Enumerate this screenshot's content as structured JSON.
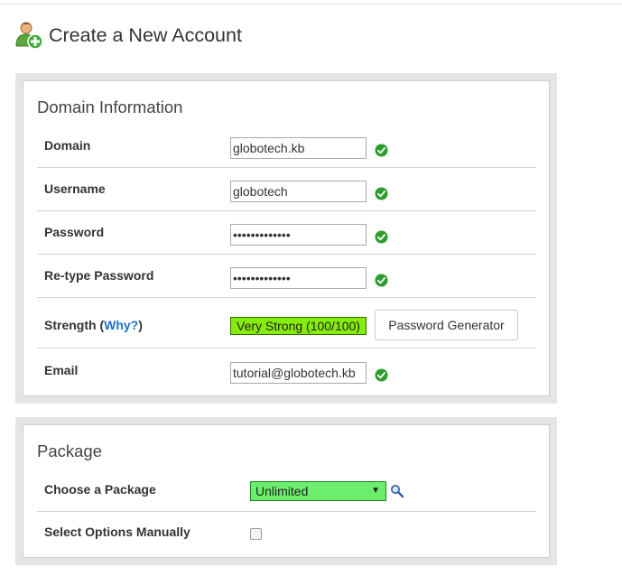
{
  "header": {
    "title": "Create a New Account",
    "icon": "user-add-icon"
  },
  "domain_section": {
    "title": "Domain Information",
    "fields": {
      "domain": {
        "label": "Domain",
        "value": "globotech.kb"
      },
      "username": {
        "label": "Username",
        "value": "globotech"
      },
      "password": {
        "label": "Password",
        "value": "•••••••••••••"
      },
      "retype": {
        "label": "Re-type Password",
        "value": "•••••••••••••"
      },
      "email": {
        "label": "Email",
        "value": "tutorial@globotech.kb"
      }
    },
    "strength": {
      "label": "Strength",
      "paren_open": " (",
      "why_link": "Why?",
      "paren_close": ")",
      "value": "Very Strong (100/100)",
      "meter_percent": 100,
      "meter_color": "#86ec0c"
    },
    "password_generator_label": "Password Generator",
    "valid_icon": "green-check-icon",
    "valid_color": "#2e9c2e"
  },
  "package_section": {
    "title": "Package",
    "choose_label": "Choose a Package",
    "selected_package": "Unlimited",
    "select_color": "#6cee6c",
    "manual_label": "Select Options Manually",
    "manual_checked": false
  }
}
